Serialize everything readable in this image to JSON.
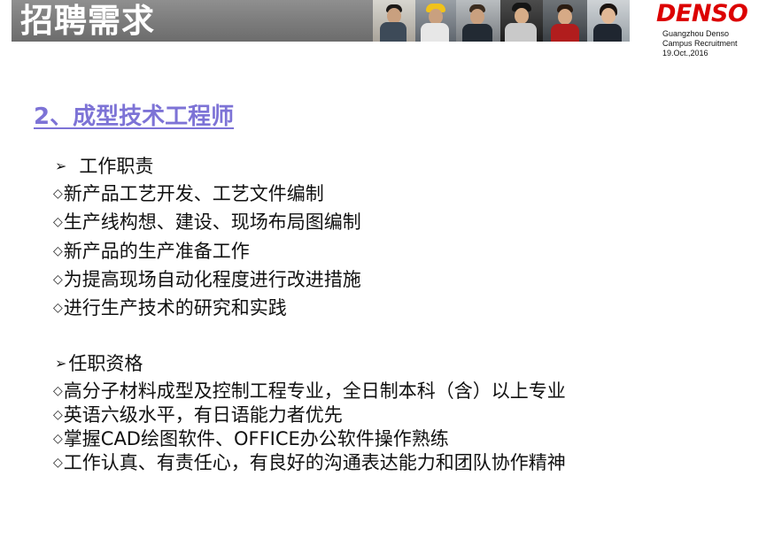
{
  "header": {
    "title": "招聘需求",
    "brand": {
      "logo": "DENSO",
      "line1": "Guangzhou Denso",
      "line2": "Campus Recruitment",
      "line3": "19.Oct.,2016"
    }
  },
  "section": {
    "title": "2、成型技术工程师"
  },
  "duties": {
    "heading": "工作职责",
    "items": [
      "新产品工艺开发、工艺文件编制",
      "生产线构想、建设、现场布局图编制",
      "新产品的生产准备工作",
      "为提高现场自动化程度进行改进措施",
      "进行生产技术的研究和实践"
    ]
  },
  "qualifications": {
    "heading": "任职资格",
    "items": [
      "高分子材料成型及控制工程专业，全日制本科（含）以上专业",
      "英语六级水平，有日语能力者优先",
      "掌握CAD绘图软件、OFFICE办公软件操作熟练",
      "工作认真、有责任心，有良好的沟通表达能力和团队协作精神"
    ]
  },
  "icons": {
    "arrow": "arrow-bullet-icon",
    "diamond": "diamond-bullet-icon"
  },
  "colors": {
    "section_title": "#7d73d6",
    "brand_red": "#dc0000",
    "header_band": "#7b7b7b"
  }
}
